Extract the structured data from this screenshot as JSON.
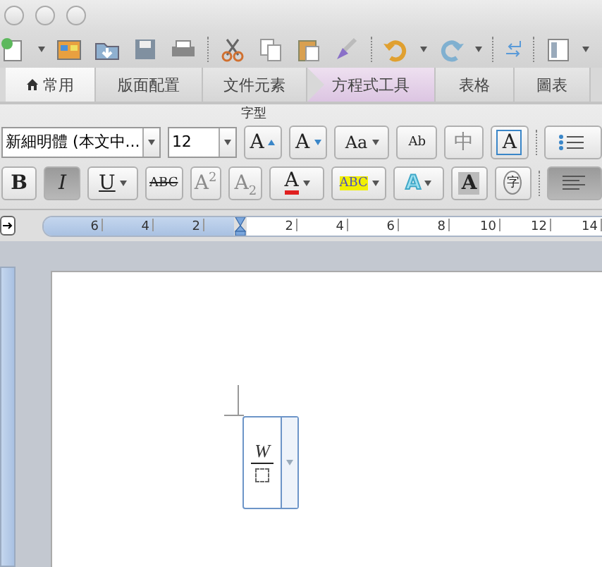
{
  "tabs": [
    {
      "label": "常用",
      "kind": "home",
      "selected": true
    },
    {
      "label": "版面配置",
      "kind": "plain",
      "selected": false
    },
    {
      "label": "文件元素",
      "kind": "plain",
      "selected": false
    },
    {
      "label": "方程式工具",
      "kind": "context",
      "selected": false
    },
    {
      "label": "表格",
      "kind": "plain",
      "selected": false
    },
    {
      "label": "圖表",
      "kind": "plain",
      "selected": false
    }
  ],
  "font_group": {
    "title": "字型",
    "font_name": "新細明體 (本文中...",
    "font_size": "12",
    "row1": [
      {
        "kind": "grow",
        "label": "A",
        "disabled": false
      },
      {
        "kind": "shrink",
        "label": "A",
        "disabled": false
      },
      {
        "kind": "case",
        "label": "Aa",
        "disabled": false
      },
      {
        "kind": "clear",
        "label": "Ab",
        "disabled": false
      },
      {
        "kind": "phonetic",
        "label": "中",
        "disabled": true
      },
      {
        "kind": "border",
        "label": "A",
        "disabled": false
      }
    ],
    "row2": [
      {
        "kind": "bold",
        "label": "B",
        "selected": false,
        "disabled": false
      },
      {
        "kind": "italic",
        "label": "I",
        "selected": true,
        "disabled": false
      },
      {
        "kind": "underline",
        "label": "U",
        "selected": false,
        "disabled": false
      },
      {
        "kind": "strike",
        "label": "ABC",
        "selected": false,
        "disabled": false
      },
      {
        "kind": "super",
        "label": "A$^{2}$",
        "selected": false,
        "disabled": true
      },
      {
        "kind": "sub",
        "label": "A$_{2}$",
        "selected": false,
        "disabled": true
      },
      {
        "kind": "color",
        "label": "A",
        "selected": false,
        "disabled": false
      },
      {
        "kind": "highlight",
        "label": "ABC",
        "selected": false,
        "disabled": false
      },
      {
        "kind": "effects",
        "label": "A",
        "selected": false,
        "disabled": false
      },
      {
        "kind": "shade",
        "label": "A",
        "selected": false,
        "disabled": false
      },
      {
        "kind": "enclose",
        "label": "字",
        "selected": false,
        "disabled": false
      }
    ]
  },
  "ruler": {
    "left_numbers": [
      "6",
      "4",
      "2"
    ],
    "right_numbers": [
      "2",
      "4",
      "6",
      "8",
      "10",
      "12",
      "14"
    ]
  },
  "equation": {
    "numerator": "W"
  }
}
